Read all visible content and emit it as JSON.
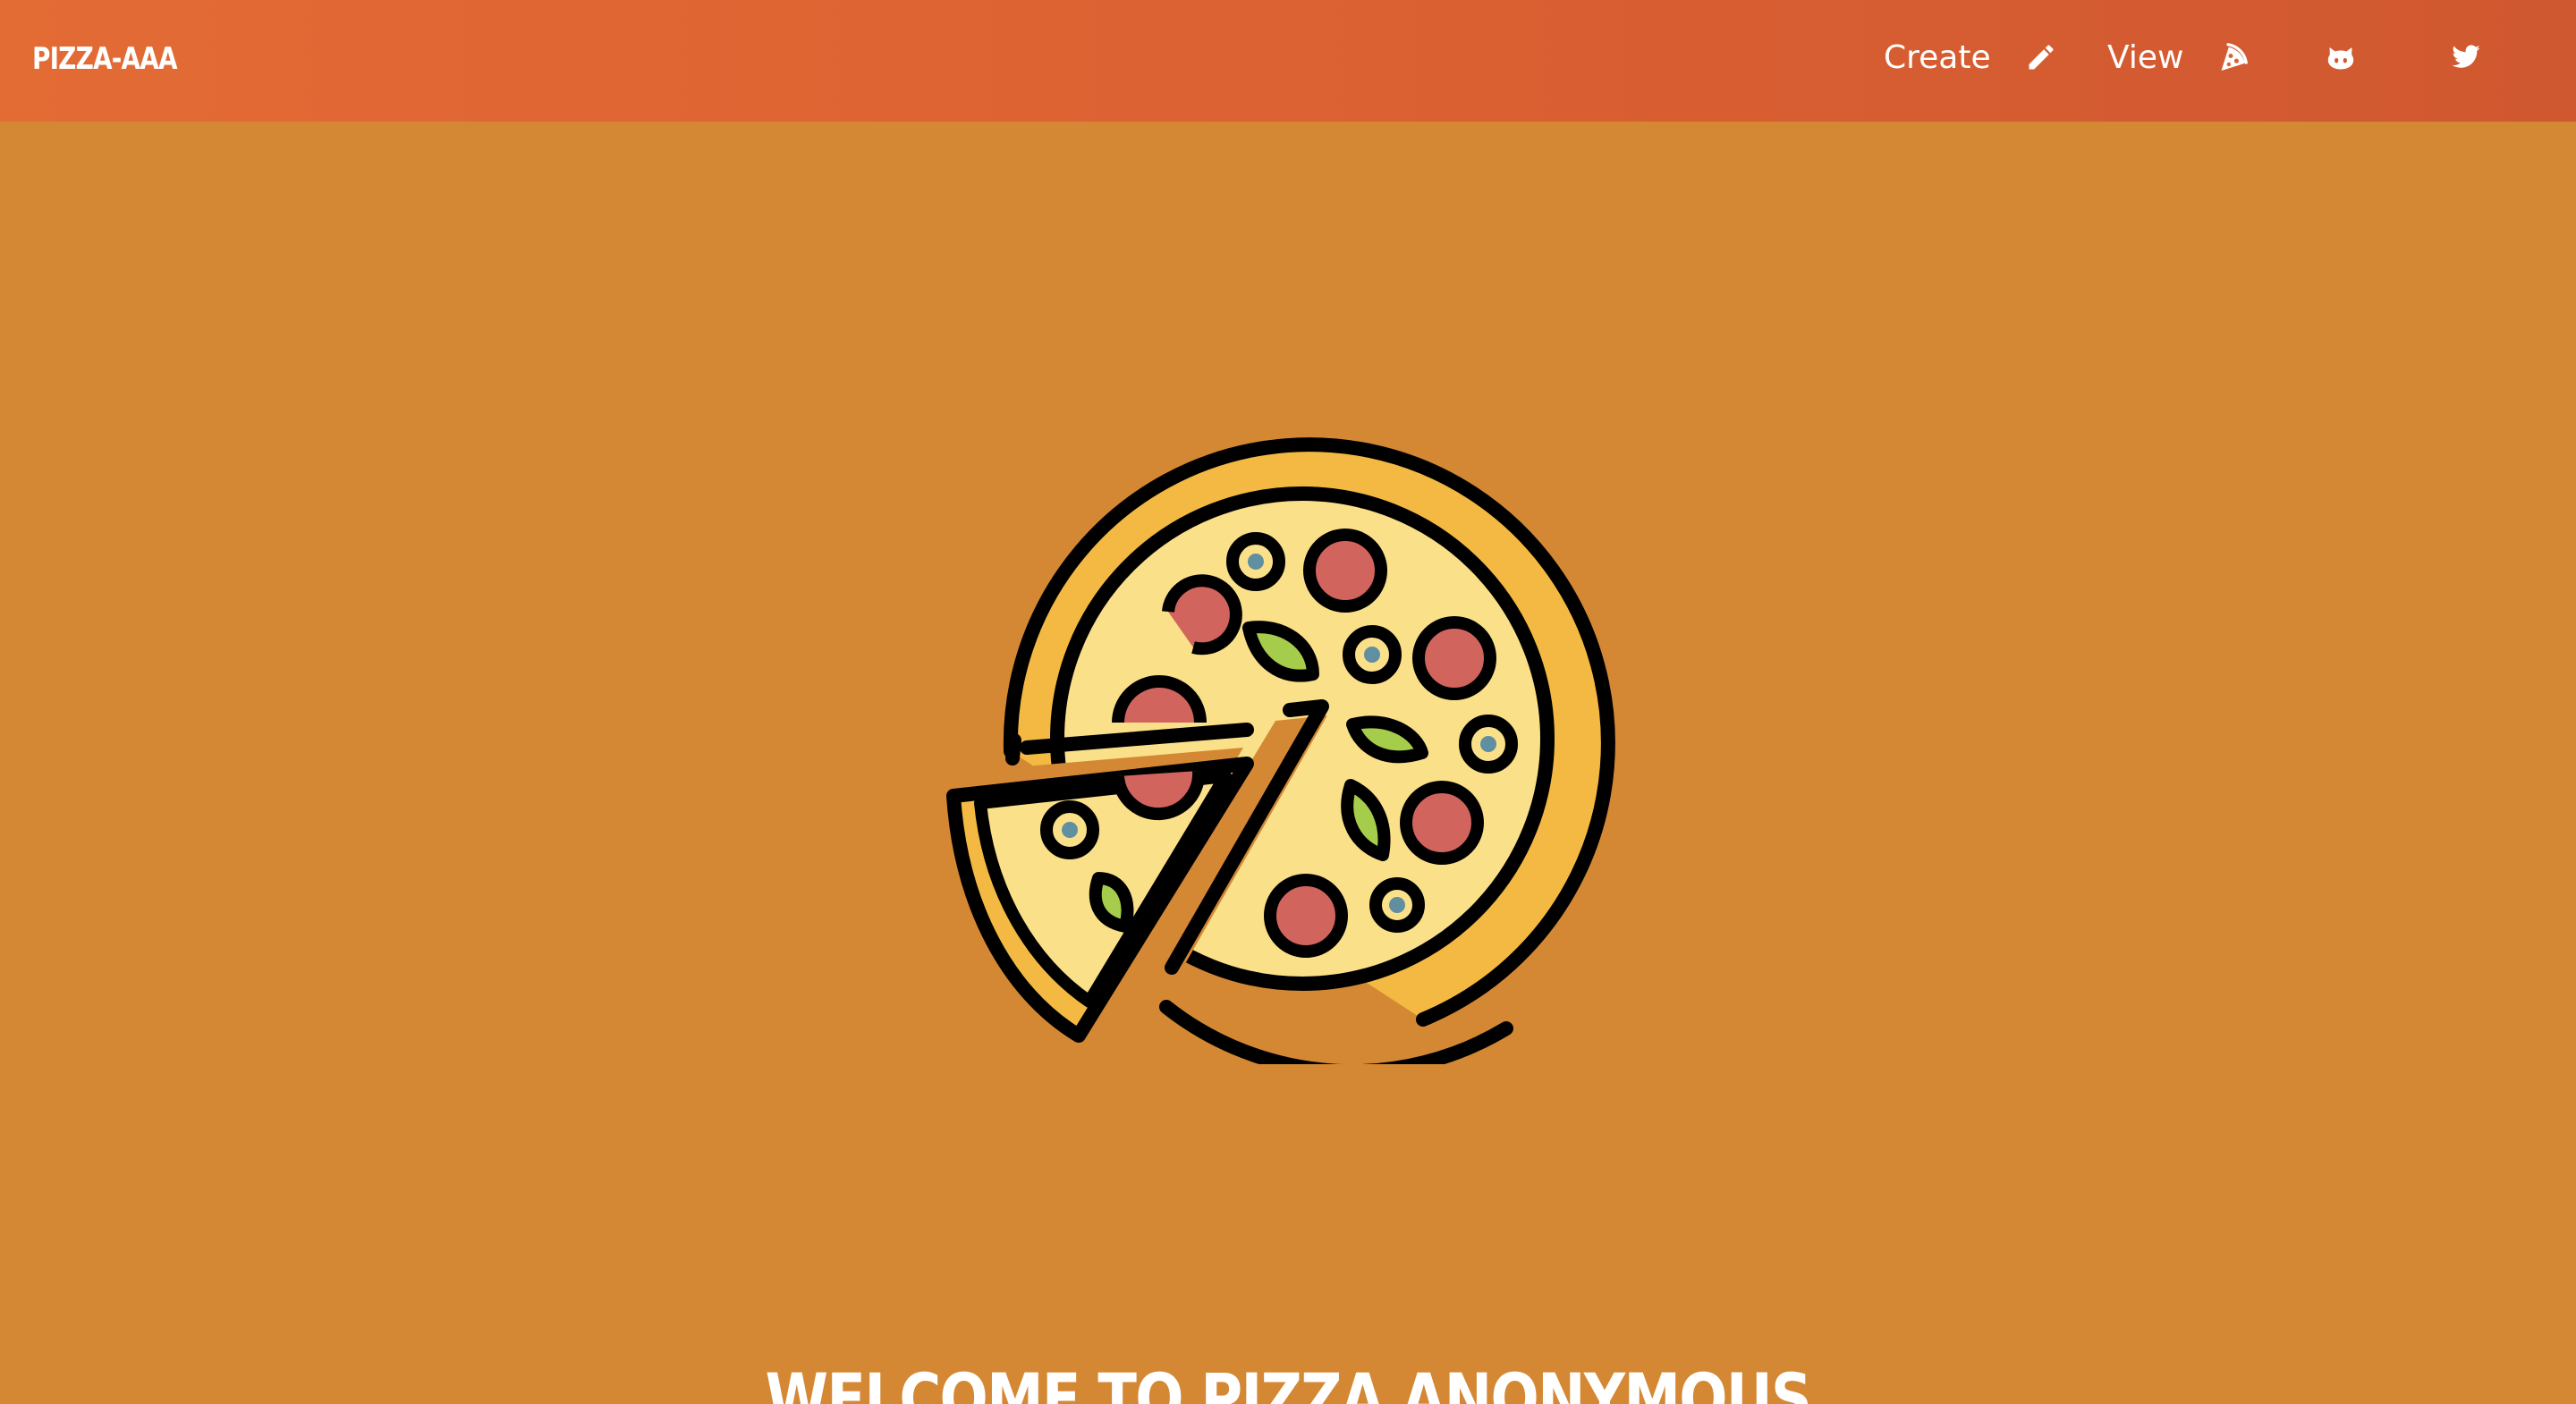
{
  "navbar": {
    "brand": "PIZZA-AAA",
    "links": [
      {
        "label": "Create",
        "icon": "pencil-icon"
      },
      {
        "label": "View",
        "icon": "pizza-slice-icon"
      },
      {
        "label": "",
        "icon": "github-icon"
      },
      {
        "label": "",
        "icon": "twitter-icon"
      }
    ]
  },
  "hero": {
    "image": "pizza-illustration",
    "heading": "WELCOME TO PIZZA ANONYMOUS"
  },
  "colors": {
    "navbar_start": "#e36b34",
    "navbar_end": "#d05830",
    "background": "#d48834",
    "crust": "#f4b942",
    "cheese": "#fbe08a",
    "pepperoni": "#d2645e",
    "olive_center": "#5f8fa0",
    "basil": "#a6cc4b",
    "outline": "#000000"
  }
}
